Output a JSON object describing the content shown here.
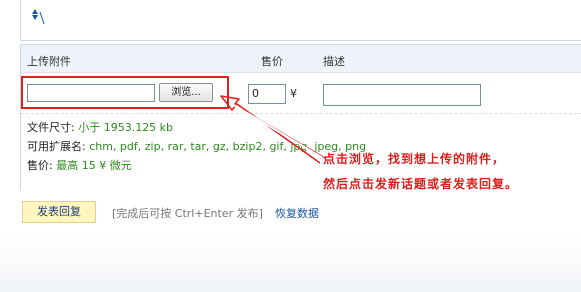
{
  "header": {
    "col_attachment": "上传附件",
    "col_price": "售价",
    "col_description": "描述"
  },
  "upload": {
    "file_value": "",
    "browse_label": "浏览...",
    "price_value": "0",
    "currency_symbol": "¥",
    "description_value": ""
  },
  "info": {
    "size_label": "文件尺寸: ",
    "size_value": "小于 1953.125 kb",
    "ext_label": "可用扩展名: ",
    "ext_value": "chm, pdf, zip, rar, tar, gz, bzip2, gif, jpg, jpeg, png",
    "price_label": "售价: ",
    "price_value": "最高 15 ¥ 微元"
  },
  "annotation": {
    "line1": "点击浏览，找到想上传的附件，",
    "line2": "然后点击发新话题或者发表回复。",
    "color": "#e21d1d"
  },
  "footer": {
    "submit_label": "发表回复",
    "hint": "[完成后可按 Ctrl+Enter 发布]",
    "restore_label": "恢复数据"
  },
  "icons": {
    "sort": "sort-icon"
  }
}
